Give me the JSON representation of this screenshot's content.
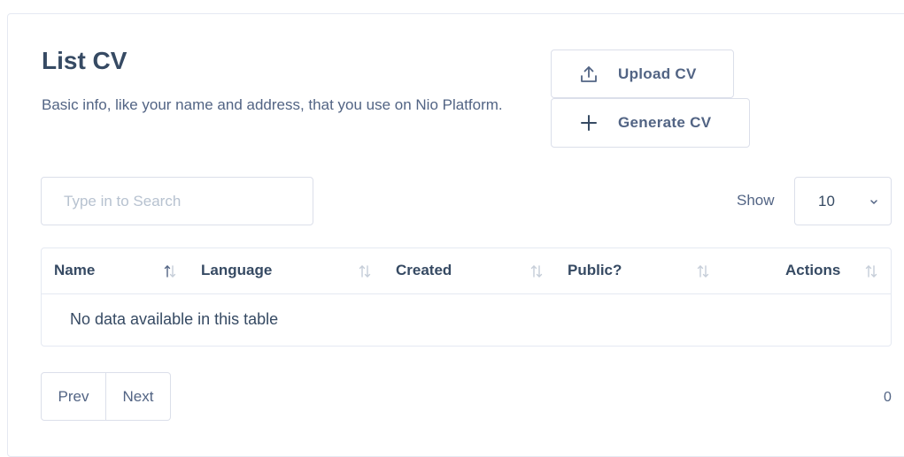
{
  "page": {
    "title": "List CV",
    "description": "Basic info, like your name and address, that you use on Nio Platform."
  },
  "actions": {
    "upload_label": "Upload CV",
    "generate_label": "Generate CV"
  },
  "search": {
    "placeholder": "Type in to Search",
    "value": ""
  },
  "page_size": {
    "label": "Show",
    "value": "10"
  },
  "table": {
    "columns": [
      "Name",
      "Language",
      "Created",
      "Public?",
      "Actions"
    ],
    "rows": [],
    "empty_message": "No data available in this table"
  },
  "pagination": {
    "prev_label": "Prev",
    "next_label": "Next",
    "info": "0"
  }
}
